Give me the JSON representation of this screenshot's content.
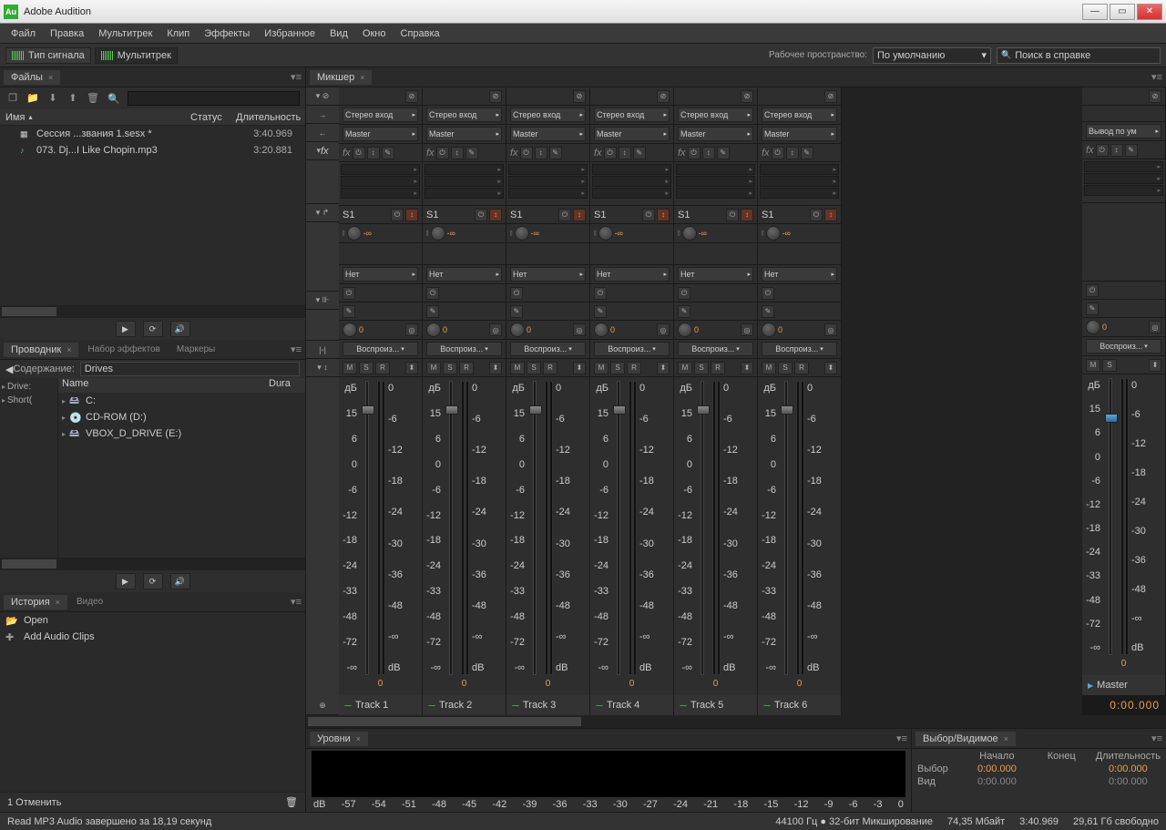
{
  "app": {
    "title": "Adobe Audition"
  },
  "menu": [
    "Файл",
    "Правка",
    "Мультитрек",
    "Клип",
    "Эффекты",
    "Избранное",
    "Вид",
    "Окно",
    "Справка"
  ],
  "toolbar": {
    "signal_type": "Тип сигнала",
    "multitrack": "Мультитрек",
    "workspace_label": "Рабочее пространство:",
    "workspace_value": "По умолчанию",
    "search_placeholder": "Поиск в справке"
  },
  "files_panel": {
    "tab": "Файлы",
    "col_name": "Имя",
    "col_status": "Статус",
    "col_duration": "Длительность",
    "rows": [
      {
        "name": "Сессия ...звания 1.sesx *",
        "duration": "3:40.969",
        "type": "session"
      },
      {
        "name": "073. Dj...I Like Chopin.mp3",
        "duration": "3:20.881",
        "type": "audio"
      }
    ]
  },
  "explorer": {
    "tabs": [
      "Проводник",
      "Набор эффектов",
      "Маркеры"
    ],
    "content_label": "Содержание:",
    "content_value": "Drives",
    "left_items": [
      "Drive:",
      "Short("
    ],
    "col_name": "Name",
    "col_dura": "Dura",
    "drives": [
      "C:",
      "CD-ROM (D:)",
      "VBOX_D_DRIVE (E:)"
    ]
  },
  "history": {
    "tabs": [
      "История",
      "Видео"
    ],
    "items": [
      "Open",
      "Add Audio Clips"
    ],
    "undo": "1 Отменить"
  },
  "mixer": {
    "tab": "Микшер",
    "stereo_in": "Стерео вход",
    "master": "Master",
    "output_master": "Вывод по ум",
    "none": "Нет",
    "play": "Воспроиз...",
    "send_label": "S1",
    "inf": "-∞",
    "zero": "0",
    "db_label": "дБ",
    "db_unit": "dB",
    "msr": [
      "M",
      "S",
      "R"
    ],
    "ms": [
      "M",
      "S"
    ],
    "scale": [
      "15",
      "6",
      "0",
      "-6",
      "-12",
      "-18",
      "-24",
      "-33",
      "-48",
      "-72",
      "-∞"
    ],
    "meter_scale": [
      "0",
      "-6",
      "-12",
      "-18",
      "-24",
      "-30",
      "-36",
      "-48",
      "-∞"
    ],
    "tracks": [
      "Track 1",
      "Track 2",
      "Track 3",
      "Track 4",
      "Track 5",
      "Track 6"
    ],
    "master_name": "Master",
    "time": "0:00.000"
  },
  "levels": {
    "tab": "Уровни",
    "scale": [
      "dB",
      "-57",
      "-54",
      "-51",
      "-48",
      "-45",
      "-42",
      "-39",
      "-36",
      "-33",
      "-30",
      "-27",
      "-24",
      "-21",
      "-18",
      "-15",
      "-12",
      "-9",
      "-6",
      "-3",
      "0"
    ]
  },
  "selection": {
    "tab": "Выбор/Видимое",
    "cols": [
      "Начало",
      "Конец",
      "Длительность"
    ],
    "row1_label": "Выбор",
    "row1": [
      "0:00.000",
      "",
      "0:00.000"
    ],
    "row2_label": "Вид",
    "row2": [
      "0:00.000",
      "",
      "0:00.000"
    ]
  },
  "status": {
    "left": "Read MP3 Audio завершено за 18,19 секунд",
    "center": "44100 Гц ● 32-бит Микширование",
    "mem": "74,35 Мбайт",
    "dur": "3:40.969",
    "disk": "29,61 Гб свободно"
  }
}
